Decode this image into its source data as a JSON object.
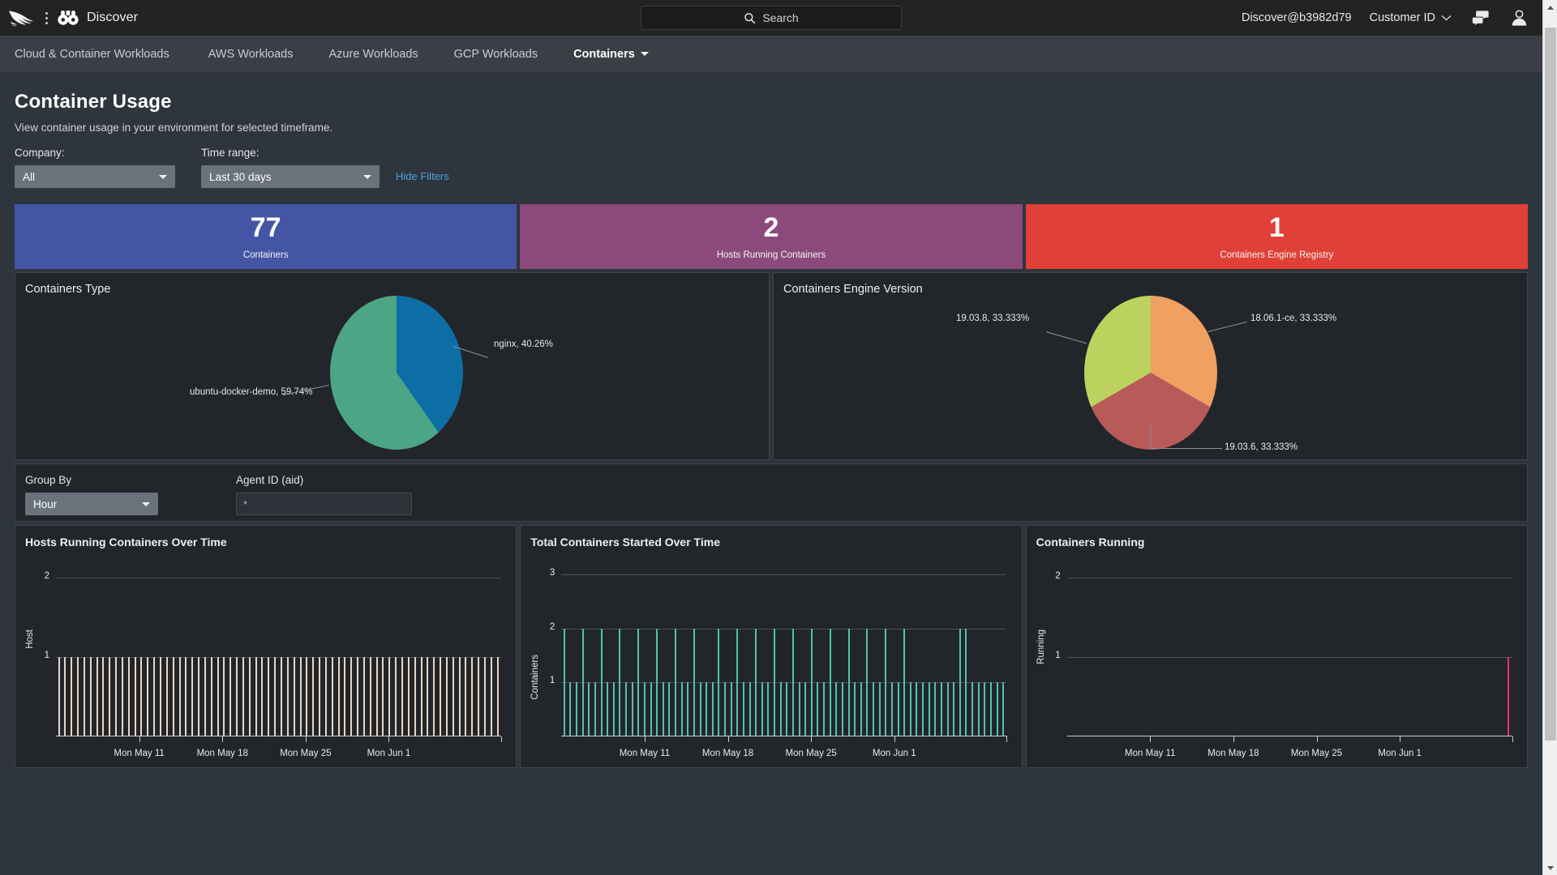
{
  "topbar": {
    "brand_name": "Discover",
    "logo_icon": "falcon-logo",
    "binoculars_icon": "binoculars-icon",
    "search_placeholder": "Search",
    "search_icon": "search-icon",
    "user_account": "Discover@b3982d79",
    "customer_id_label": "Customer ID",
    "chevron_icon": "chevron-down-icon",
    "chat_icon": "chat-icon",
    "avatar_icon": "user-avatar-icon"
  },
  "nav": {
    "items": [
      {
        "label": "Cloud & Container Workloads",
        "active": false
      },
      {
        "label": "AWS Workloads",
        "active": false
      },
      {
        "label": "Azure Workloads",
        "active": false
      },
      {
        "label": "GCP Workloads",
        "active": false
      },
      {
        "label": "Containers",
        "active": true
      }
    ]
  },
  "page": {
    "title": "Container Usage",
    "subtitle": "View container usage in your environment for selected timeframe.",
    "filters": {
      "company_label": "Company:",
      "company_value": "All",
      "time_label": "Time range:",
      "time_value": "Last 30 days",
      "hide_filters_label": "Hide Filters",
      "link_color": "#4aa3e0"
    }
  },
  "kpis": [
    {
      "value": "77",
      "label": "Containers",
      "color": "#4455a5"
    },
    {
      "value": "2",
      "label": "Hosts Running Containers",
      "color": "#8c4a7c"
    },
    {
      "value": "1",
      "label": "Containers Engine Registry",
      "color": "#e04038"
    }
  ],
  "group_controls": {
    "group_by_label": "Group By",
    "group_by_value": "Hour",
    "agent_id_label": "Agent ID (aid)",
    "agent_id_value": "*"
  },
  "chart_data": [
    {
      "type": "pie",
      "title": "Containers Type",
      "labels": [
        "nginx",
        "ubuntu-docker-demo"
      ],
      "values": [
        40.26,
        59.74
      ],
      "value_labels": [
        "nginx, 40.26%",
        "ubuntu-docker-demo, 59.74%"
      ],
      "colors": [
        "#0c6ea4",
        "#4ca585"
      ],
      "legend": "callout-labels"
    },
    {
      "type": "pie",
      "title": "Containers Engine Version",
      "labels": [
        "18.06.1-ce",
        "19.03.6",
        "19.03.8"
      ],
      "values": [
        33.333,
        33.333,
        33.333
      ],
      "value_labels": [
        "18.06.1-ce, 33.333%",
        "19.03.6, 33.333%",
        "19.03.8, 33.333%"
      ],
      "colors": [
        "#f0a060",
        "#b85a5a",
        "#bcd25f"
      ],
      "legend": "callout-labels"
    },
    {
      "type": "bar",
      "title": "Hosts Running Containers Over Time",
      "ylabel": "Host",
      "xlabel": "",
      "yticks": [
        1,
        2
      ],
      "ylim": [
        0,
        2.25
      ],
      "xticklabels": [
        "Mon May 11",
        "Mon May 18",
        "Mon May 25",
        "Mon Jun 1"
      ],
      "bar_color": "#e8d6c4",
      "values": [
        1,
        1,
        1,
        1,
        1,
        1,
        1,
        1,
        1,
        1,
        1,
        1,
        1,
        1,
        1,
        1,
        1,
        1,
        1,
        1,
        1,
        1,
        1,
        1,
        1,
        1,
        1,
        1,
        1,
        1,
        1,
        1,
        1,
        1,
        1,
        1,
        1,
        1,
        1,
        1,
        1,
        1,
        1,
        1,
        1,
        1,
        1,
        1,
        1,
        1,
        1,
        1,
        1,
        1,
        1,
        1,
        1,
        1,
        1,
        1,
        1,
        1,
        1,
        1,
        1,
        1,
        1,
        1,
        1,
        1
      ]
    },
    {
      "type": "bar",
      "title": "Total Containers Started Over Time",
      "ylabel": "Containers",
      "xlabel": "",
      "yticks": [
        1,
        2,
        3
      ],
      "ylim": [
        0,
        3.3
      ],
      "xticklabels": [
        "Mon May 11",
        "Mon May 18",
        "Mon May 25",
        "Mon Jun 1"
      ],
      "bar_color": "#56bfae",
      "values": [
        2,
        1,
        1,
        2,
        1,
        1,
        2,
        1,
        1,
        2,
        1,
        1,
        2,
        1,
        1,
        2,
        1,
        1,
        2,
        1,
        1,
        2,
        1,
        1,
        1,
        2,
        1,
        1,
        2,
        1,
        1,
        2,
        1,
        1,
        2,
        1,
        1,
        2,
        1,
        1,
        2,
        1,
        1,
        2,
        1,
        1,
        2,
        1,
        1,
        2,
        1,
        1,
        2,
        1,
        1,
        2,
        1,
        1,
        1,
        1,
        1,
        1,
        1,
        1,
        2,
        2,
        1,
        1,
        1,
        1,
        1,
        1
      ]
    },
    {
      "type": "bar",
      "title": "Containers Running",
      "ylabel": "Running",
      "xlabel": "",
      "yticks": [
        1,
        2
      ],
      "ylim": [
        0,
        2.25
      ],
      "xticklabels": [
        "Mon May 11",
        "Mon May 18",
        "Mon May 25",
        "Mon Jun 1"
      ],
      "bar_color": "#e8365d",
      "values": [
        0,
        0,
        0,
        0,
        0,
        0,
        0,
        0,
        0,
        0,
        0,
        0,
        0,
        0,
        0,
        0,
        0,
        0,
        0,
        0,
        0,
        0,
        0,
        0,
        0,
        0,
        0,
        0,
        0,
        0,
        0,
        0,
        0,
        0,
        0,
        0,
        0,
        0,
        0,
        0,
        0,
        0,
        0,
        0,
        0,
        0,
        0,
        0,
        0,
        0,
        0,
        0,
        0,
        0,
        0,
        0,
        0,
        0,
        0,
        0,
        0,
        0,
        0,
        0,
        0,
        0,
        0,
        0,
        0,
        1
      ]
    }
  ],
  "scrollbar": {
    "up_arrow": "scroll-up-arrow",
    "down_arrow": "scroll-down-arrow",
    "thumb": "scroll-thumb"
  }
}
